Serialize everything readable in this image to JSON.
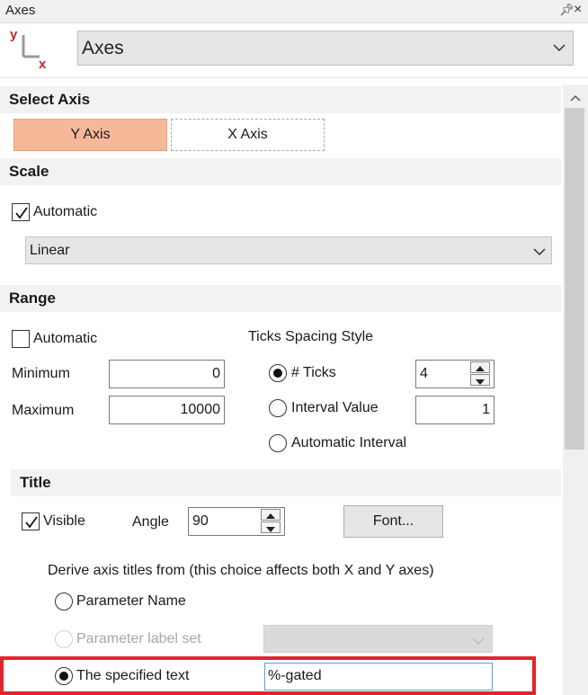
{
  "window": {
    "title": "Axes"
  },
  "header": {
    "selector_value": "Axes",
    "logo_y": "y",
    "logo_x": "x"
  },
  "select_axis": {
    "heading": "Select Axis",
    "y_label": "Y Axis",
    "x_label": "X Axis",
    "selected": "Y Axis"
  },
  "scale": {
    "heading": "Scale",
    "automatic_label": "Automatic",
    "automatic_checked": true,
    "type_value": "Linear"
  },
  "range": {
    "heading": "Range",
    "automatic_label": "Automatic",
    "automatic_checked": false,
    "minimum_label": "Minimum",
    "minimum_value": "0",
    "maximum_label": "Maximum",
    "maximum_value": "10000",
    "ticks_heading": "Ticks Spacing Style",
    "ticks_label": "# Ticks",
    "ticks_value": "4",
    "interval_label": "Interval Value",
    "interval_value": "1",
    "auto_interval_label": "Automatic Interval",
    "selected_style": "# Ticks"
  },
  "title": {
    "heading": "Title",
    "visible_label": "Visible",
    "visible_checked": true,
    "angle_label": "Angle",
    "angle_value": "90",
    "font_button": "Font...",
    "derive_text": "Derive axis titles from (this choice affects both X and Y axes)",
    "opt_param_name": "Parameter Name",
    "opt_label_set": "Parameter label set",
    "opt_specified": "The specified text",
    "specified_value": "%-gated",
    "selected_option": "The specified text"
  },
  "colors": {
    "accent": "#f7b89a",
    "highlight": "#e1252c"
  }
}
